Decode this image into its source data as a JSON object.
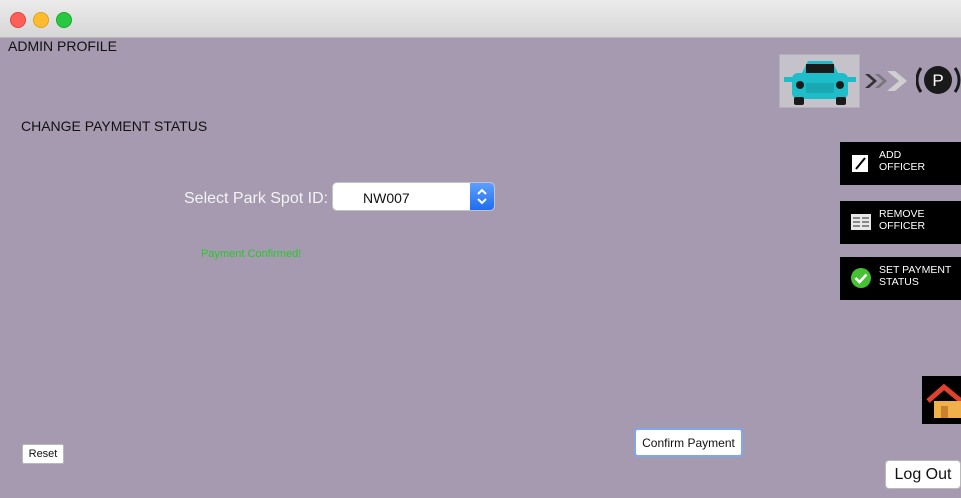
{
  "window": {
    "title": "ADMIN PROFILE"
  },
  "section": {
    "title": "CHANGE PAYMENT STATUS"
  },
  "form": {
    "select_label": "Select Park Spot ID:",
    "select_value": "NW007",
    "status_message": "Payment Confirmed!",
    "confirm_label": "Confirm Payment",
    "reset_label": "Reset"
  },
  "sidebar": {
    "buttons": [
      {
        "label": "ADD\nOFFICER",
        "icon": "pencil-icon"
      },
      {
        "label": "REMOVE\nOFFICER",
        "icon": "list-icon"
      },
      {
        "label": "SET PAYMENT\nSTATUS",
        "icon": "check-icon"
      }
    ],
    "home_icon": "home-icon"
  },
  "logo": {
    "letter": "P",
    "icons": [
      "car-icon",
      "double-chevron-icon",
      "parking-icon"
    ]
  },
  "logout_label": "Log Out",
  "colors": {
    "background": "#a59ab0",
    "status_green": "#26c928",
    "car_teal": "#1dbdc9",
    "select_accent": "#1e6df0"
  }
}
